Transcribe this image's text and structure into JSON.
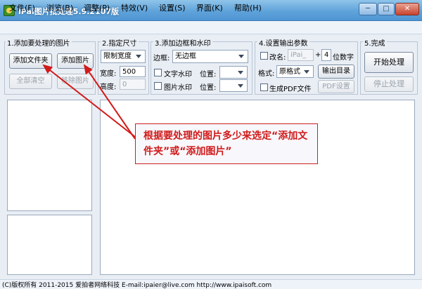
{
  "window": {
    "title": "iPai图片批处理5.9.2107版",
    "minimize": "─",
    "maximize": "□",
    "close": "✕"
  },
  "menu": [
    "文件(F)",
    "浏览(B)",
    "调整(P)",
    "特效(V)",
    "设置(S)",
    "界面(K)",
    "帮助(H)"
  ],
  "step1": {
    "title": "1.添加要处理的图片",
    "add_folder": "添加文件夹",
    "add_image": "添加图片",
    "clear_all": "全部清空",
    "remove_image": "移除图片"
  },
  "step2": {
    "title": "2.指定尺寸",
    "mode": "限制宽度",
    "width_label": "宽度:",
    "width_value": "500",
    "height_label": "高度:",
    "height_value": "0"
  },
  "step3": {
    "title": "3.添加边框和水印",
    "border_label": "边框:",
    "border_value": "无边框",
    "text_watermark": "文字水印",
    "image_watermark": "图片水印",
    "position_label": "位置:"
  },
  "step4": {
    "title": "4.设置输出参数",
    "rename_label": "改名:",
    "rename_placeholder": "iPai_",
    "plus": "+",
    "digits_value": "4",
    "digits_label": "位数字",
    "format_label": "格式:",
    "format_value": "原格式",
    "output_dir": "输出目录",
    "gen_pdf": "生成PDF文件",
    "pdf_settings": "PDF设置"
  },
  "step5": {
    "title": "5.完成",
    "start": "开始处理",
    "stop": "停止处理"
  },
  "annotation": {
    "text": "根据要处理的图片多少来选定“添加文件夹”或“添加图片”",
    "color": "#d11a1a"
  },
  "status": {
    "text": "(C)版权所有 2011-2015 爱拍者网络科技 E-mail:ipaier@live.com http://www.ipaisoft.com"
  }
}
